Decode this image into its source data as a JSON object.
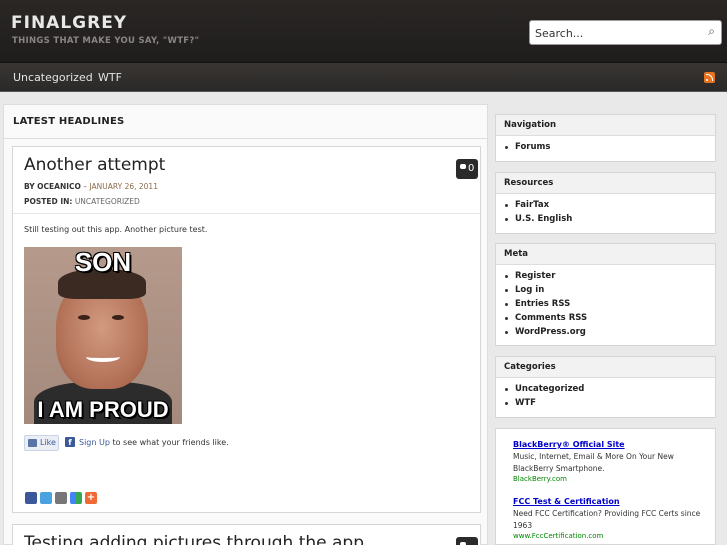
{
  "header": {
    "site_title": "FINALGREY",
    "site_description": "THINGS THAT MAKE YOU SAY, \"WTF?\"",
    "search_placeholder": "Search..."
  },
  "nav": {
    "items": [
      "Uncategorized",
      "WTF"
    ],
    "rss_icon": "rss-icon"
  },
  "main": {
    "section_title": "LATEST HEADLINES",
    "posts": [
      {
        "title": "Another attempt",
        "comment_count": "0",
        "by_label": "BY",
        "author": "OCEANICO",
        "date": "JANUARY 26, 2011",
        "posted_in_label": "POSTED IN:",
        "category": "UNCATEGORIZED",
        "excerpt": "Still testing out this app. Another picture test.",
        "image": {
          "top_text": "SON",
          "bottom_text": "I AM PROUD"
        },
        "like": {
          "button_label": "Like",
          "signup_link": "Sign Up",
          "signup_text": "to see what your friends like."
        }
      },
      {
        "title": "Testing adding pictures through the app"
      }
    ]
  },
  "sidebar": {
    "widgets": [
      {
        "title": "Navigation",
        "items": [
          "Forums"
        ]
      },
      {
        "title": "Resources",
        "items": [
          "FairTax",
          "U.S. English"
        ]
      },
      {
        "title": "Meta",
        "items": [
          "Register",
          "Log in",
          "Entries RSS",
          "Comments RSS",
          "WordPress.org"
        ]
      },
      {
        "title": "Categories",
        "items": [
          "Uncategorized",
          "WTF"
        ]
      }
    ],
    "ads": [
      {
        "title": "BlackBerry® Official Site",
        "text": "Music, Internet, Email & More On Your New BlackBerry Smartphone.",
        "url": "BlackBerry.com"
      },
      {
        "title": "FCC Test & Certification",
        "text": "Need FCC Certification? Providing FCC Certs since 1963",
        "url": "www.FccCertification.com"
      }
    ]
  },
  "colors": {
    "header_bg": "#2a2725",
    "nav_bg": "#383533",
    "rss_orange": "#e5731f",
    "ad_link": "#0000cc",
    "ad_url": "#008800"
  }
}
